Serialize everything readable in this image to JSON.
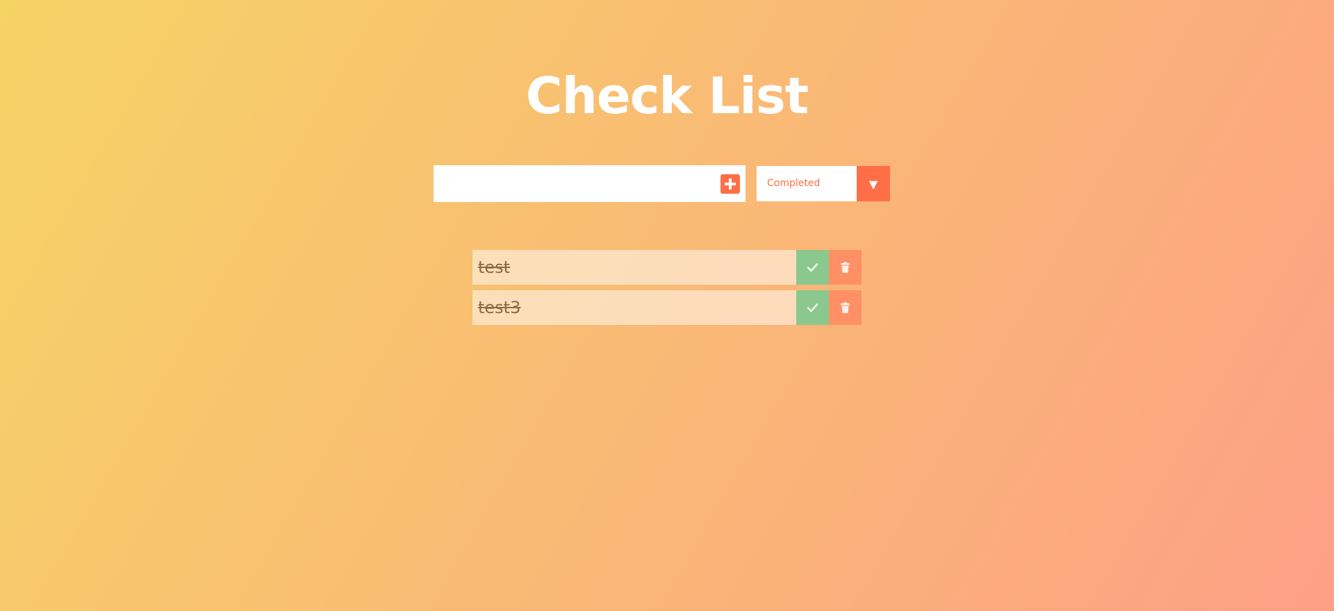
{
  "header": {
    "title": "Check List"
  },
  "add_form": {
    "input_value": "",
    "input_placeholder": "",
    "add_icon": "plus-square-icon"
  },
  "filter": {
    "selected": "Completed",
    "arrow": "▼"
  },
  "todos": [
    {
      "text": "test",
      "completed": true
    },
    {
      "text": "test3",
      "completed": true
    }
  ],
  "colors": {
    "gradient_start": "#f6d365",
    "gradient_end": "#fda085",
    "accent": "#ff6f47",
    "check": "#8ac88e",
    "trash": "#ff9065"
  }
}
